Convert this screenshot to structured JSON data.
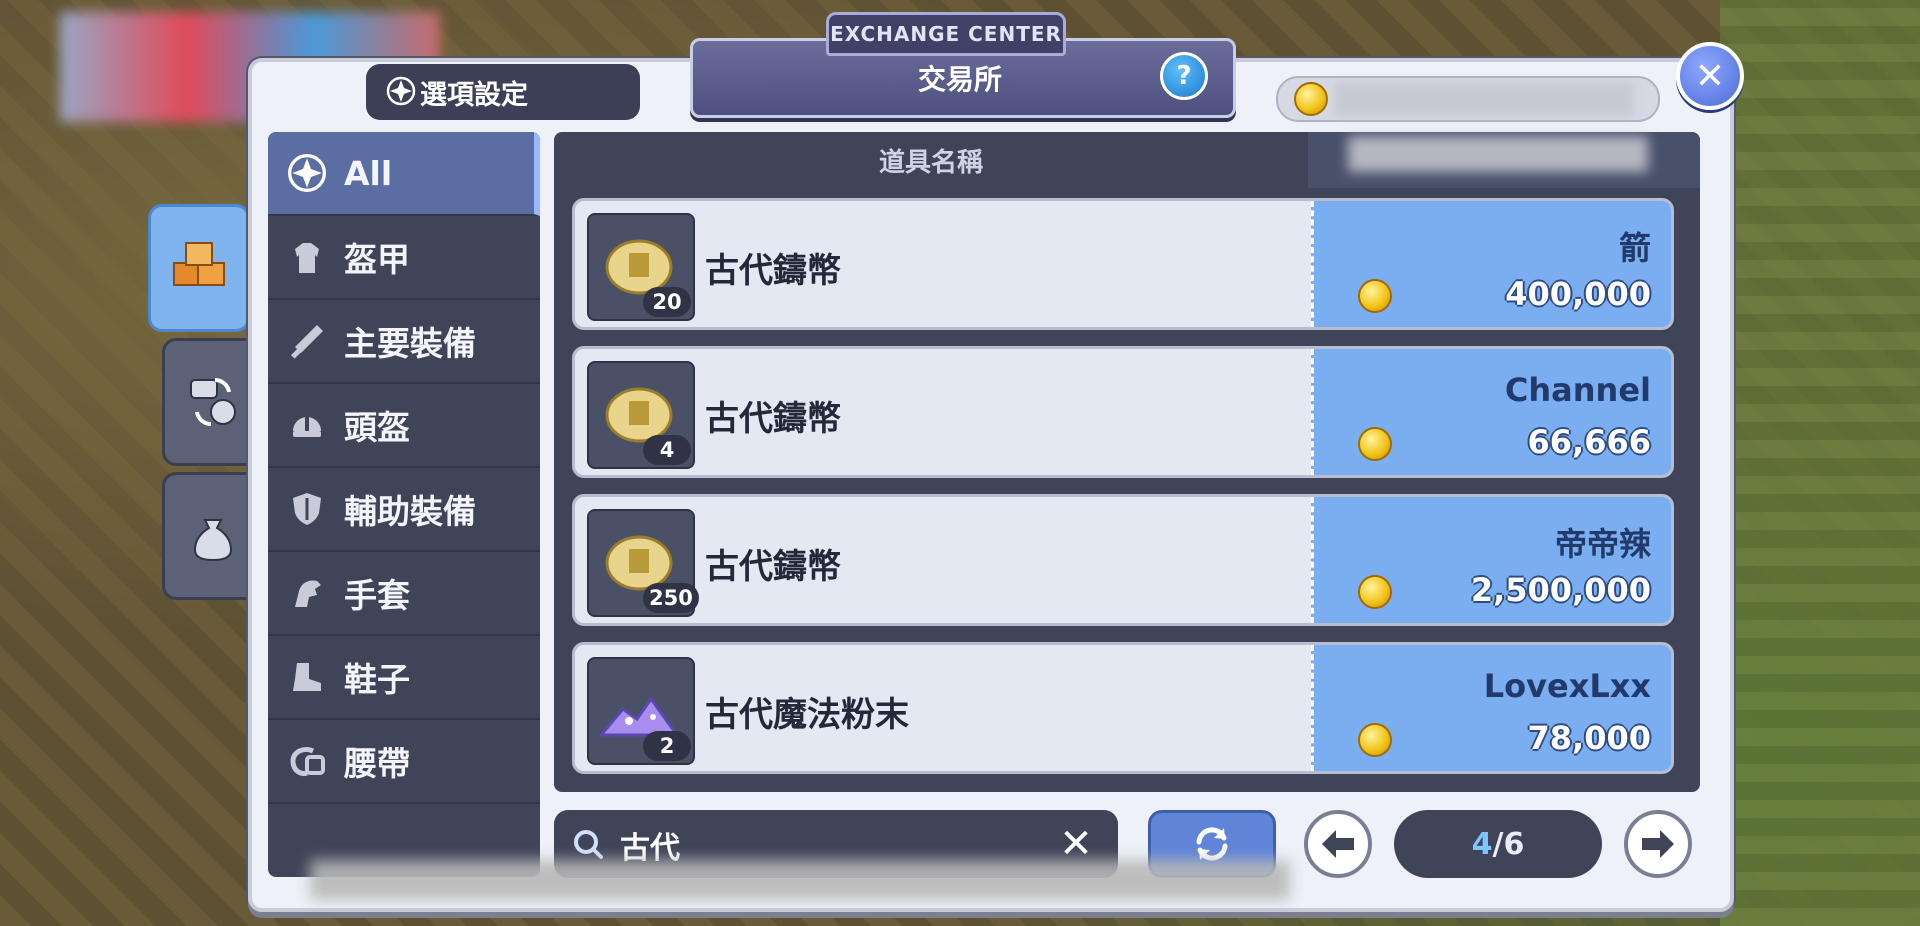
{
  "header": {
    "tab_label": "EXCHANGE CENTER",
    "title": "交易所",
    "help_label": "?",
    "options_label": "選項設定"
  },
  "categories": [
    {
      "label": "All",
      "icon": "compass-star-icon",
      "active": true
    },
    {
      "label": "盔甲",
      "icon": "armor-icon"
    },
    {
      "label": "主要裝備",
      "icon": "sword-icon"
    },
    {
      "label": "頭盔",
      "icon": "helmet-icon"
    },
    {
      "label": "輔助裝備",
      "icon": "shield-icon"
    },
    {
      "label": "手套",
      "icon": "glove-icon"
    },
    {
      "label": "鞋子",
      "icon": "boot-icon"
    },
    {
      "label": "腰帶",
      "icon": "belt-icon"
    }
  ],
  "list": {
    "col_item": "道具名稱",
    "rows": [
      {
        "name": "古代鑄幣",
        "qty": "20",
        "seller": "箭",
        "price": "400,000",
        "icon": "coin-item-icon"
      },
      {
        "name": "古代鑄幣",
        "qty": "4",
        "seller": "Channel",
        "price": "66,666",
        "icon": "coin-item-icon"
      },
      {
        "name": "古代鑄幣",
        "qty": "250",
        "seller": "帝帝辣",
        "price": "2,500,000",
        "icon": "coin-item-icon"
      },
      {
        "name": "古代魔法粉末",
        "qty": "2",
        "seller": "LovexLxx",
        "price": "78,000",
        "icon": "magic-powder-icon"
      }
    ]
  },
  "search": {
    "value": "古代"
  },
  "pagination": {
    "current": "4",
    "total": "/6"
  },
  "colors": {
    "accent": "#7aaef0",
    "panel": "#3f4458",
    "active_cat": "#5b6ea3"
  }
}
